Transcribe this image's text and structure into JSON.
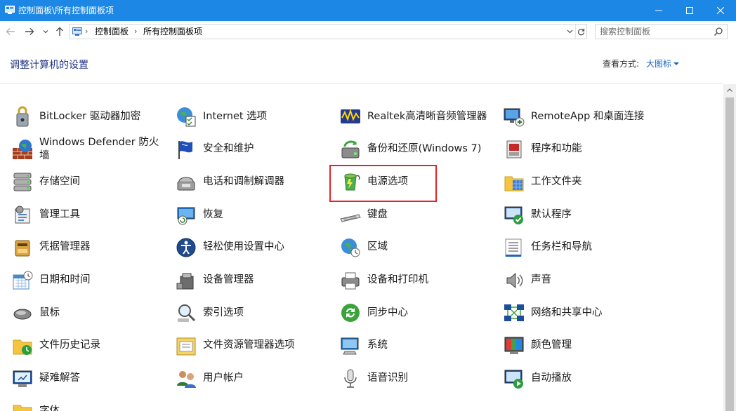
{
  "window": {
    "title": "控制面板\\所有控制面板项"
  },
  "address": {
    "crumbs": [
      "控制面板",
      "所有控制面板项"
    ],
    "search_placeholder": "搜索控制面板"
  },
  "header": {
    "title": "调整计算机的设置",
    "view_by_label": "查看方式:",
    "view_by_value": "大图标"
  },
  "colors": {
    "titlebar": "#1c87e5",
    "header_title": "#1e3287",
    "link": "#1565c0",
    "highlight": "#e62323"
  },
  "items": [
    {
      "label": "BitLocker 驱动器加密",
      "icon": "bitlocker-icon"
    },
    {
      "label": "Internet 选项",
      "icon": "internet-options-icon"
    },
    {
      "label": "Realtek高清晰音频管理器",
      "icon": "realtek-audio-icon"
    },
    {
      "label": "RemoteApp 和桌面连接",
      "icon": "remoteapp-icon"
    },
    {
      "label": "Windows Defender 防火墙",
      "icon": "firewall-icon"
    },
    {
      "label": "安全和维护",
      "icon": "security-flag-icon"
    },
    {
      "label": "备份和还原(Windows 7)",
      "icon": "backup-icon"
    },
    {
      "label": "程序和功能",
      "icon": "programs-icon"
    },
    {
      "label": "存储空间",
      "icon": "storage-icon"
    },
    {
      "label": "电话和调制解调器",
      "icon": "phone-modem-icon"
    },
    {
      "label": "电源选项",
      "icon": "power-options-icon"
    },
    {
      "label": "工作文件夹",
      "icon": "work-folders-icon"
    },
    {
      "label": "管理工具",
      "icon": "admin-tools-icon"
    },
    {
      "label": "恢复",
      "icon": "recovery-icon"
    },
    {
      "label": "键盘",
      "icon": "keyboard-icon"
    },
    {
      "label": "默认程序",
      "icon": "default-programs-icon"
    },
    {
      "label": "凭据管理器",
      "icon": "credential-icon"
    },
    {
      "label": "轻松使用设置中心",
      "icon": "ease-of-access-icon"
    },
    {
      "label": "区域",
      "icon": "region-icon"
    },
    {
      "label": "任务栏和导航",
      "icon": "taskbar-icon"
    },
    {
      "label": "日期和时间",
      "icon": "date-time-icon"
    },
    {
      "label": "设备管理器",
      "icon": "device-manager-icon"
    },
    {
      "label": "设备和打印机",
      "icon": "printer-icon"
    },
    {
      "label": "声音",
      "icon": "sound-icon"
    },
    {
      "label": "鼠标",
      "icon": "mouse-icon"
    },
    {
      "label": "索引选项",
      "icon": "indexing-icon"
    },
    {
      "label": "同步中心",
      "icon": "sync-icon"
    },
    {
      "label": "网络和共享中心",
      "icon": "network-icon"
    },
    {
      "label": "文件历史记录",
      "icon": "file-history-icon"
    },
    {
      "label": "文件资源管理器选项",
      "icon": "explorer-options-icon"
    },
    {
      "label": "系统",
      "icon": "system-icon"
    },
    {
      "label": "颜色管理",
      "icon": "color-management-icon"
    },
    {
      "label": "疑难解答",
      "icon": "troubleshoot-icon"
    },
    {
      "label": "用户帐户",
      "icon": "user-accounts-icon"
    },
    {
      "label": "语音识别",
      "icon": "speech-icon"
    },
    {
      "label": "自动播放",
      "icon": "autoplay-icon"
    },
    {
      "label": "字体",
      "icon": "fonts-icon"
    }
  ]
}
